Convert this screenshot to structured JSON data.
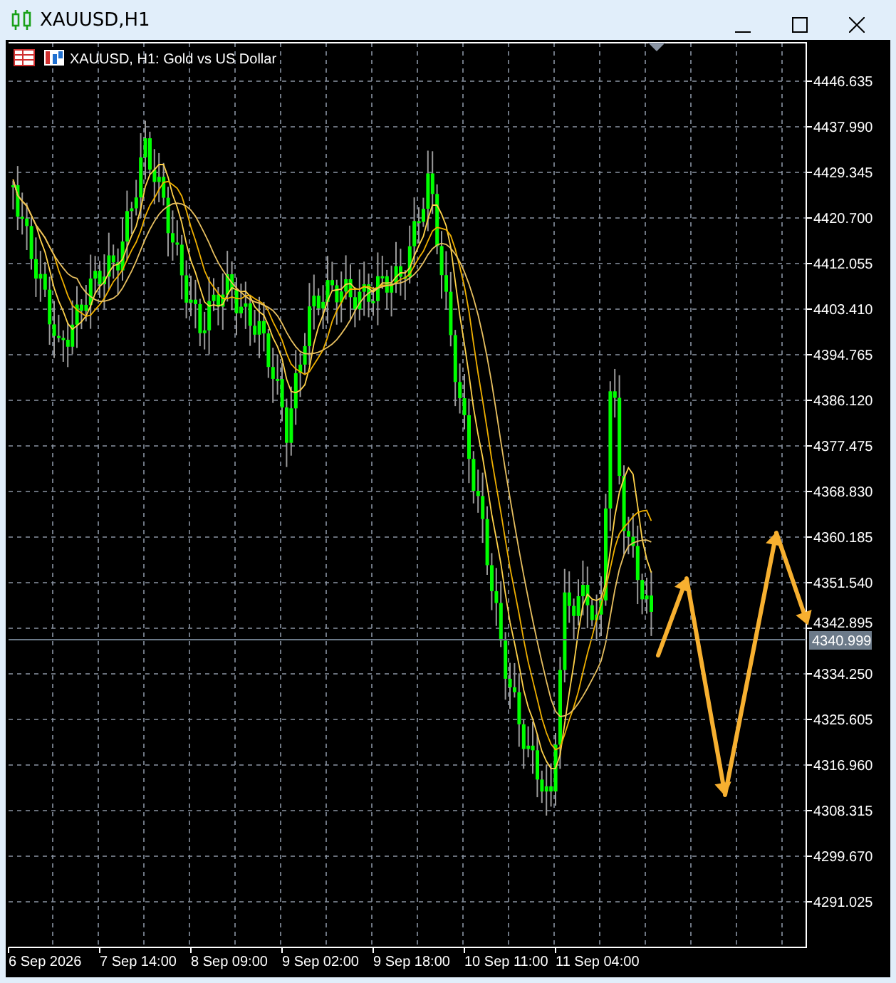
{
  "window": {
    "title": "XAUUSD,H1"
  },
  "chart": {
    "label": "XAUUSD, H1:  Gold vs US Dollar",
    "price_ticks": [
      "4446.635",
      "4437.990",
      "4429.345",
      "4420.700",
      "4412.055",
      "4403.410",
      "4394.765",
      "4386.120",
      "4377.475",
      "4368.830",
      "4360.185",
      "4351.540",
      "4342.895",
      "4334.250",
      "4325.605",
      "4316.960",
      "4308.315",
      "4299.670",
      "4291.025"
    ],
    "current_price": "4340.999",
    "time_ticks": [
      "6 Sep 2026",
      "7 Sep 14:00",
      "8 Sep 09:00",
      "9 Sep 02:00",
      "9 Sep 18:00",
      "10 Sep 11:00",
      "11 Sep 04:00"
    ]
  }
}
